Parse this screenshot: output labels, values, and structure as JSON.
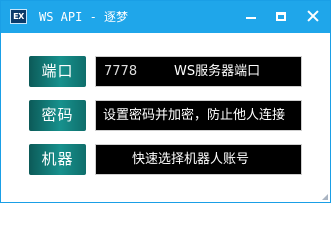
{
  "window": {
    "icon_text": "EX",
    "title": "WS API - 逐梦",
    "accent": "#1fa6ea"
  },
  "form": {
    "port": {
      "label": "端口",
      "value": "7778",
      "hint": "WS服务器端口"
    },
    "password": {
      "label": "密码",
      "hint": "设置密码并加密，防止他人连接"
    },
    "robot": {
      "label": "机器",
      "hint": "快速选择机器人账号"
    }
  },
  "icons": {
    "app": "app-icon",
    "minimize": "minimize-icon",
    "maximize": "maximize-icon",
    "close": "close-icon"
  }
}
